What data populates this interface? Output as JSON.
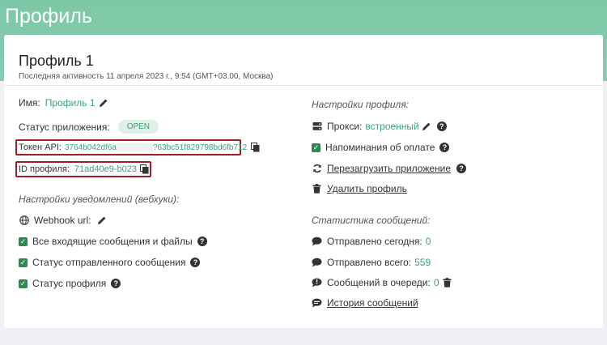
{
  "app": {
    "title": "Профиль"
  },
  "profile": {
    "title": "Профиль 1",
    "last_activity": "Последняя активность 11 апреля 2023 г., 9:54 (GMT+03.00, Москва)",
    "name_label": "Имя:",
    "name_value": "Профиль 1",
    "status_label": "Статус приложения:",
    "status_value": "OPEN",
    "token_label": "Токен API:",
    "token_value_start": "3764b042df6a",
    "token_value_end": "?63bc51f829798bd6fb712",
    "id_label": "ID профиля:",
    "id_value": "71ad40e9-b023"
  },
  "notifications": {
    "title": "Настройки уведомлений (вебхуки):",
    "webhook_label": "Webhook url:",
    "items": [
      "Все входящие сообщения и файлы",
      "Статус отправленного сообщения",
      "Статус профиля"
    ]
  },
  "settings": {
    "title": "Настройки профиля:",
    "proxy_label": "Прокси:",
    "proxy_value": "встроенный",
    "payment_reminders": "Напоминания об оплате",
    "restart_app": "Перезагрузить приложение",
    "delete_profile": "Удалить профиль"
  },
  "stats": {
    "title": "Статистика сообщений:",
    "sent_today_label": "Отправлено сегодня:",
    "sent_today_value": "0",
    "sent_total_label": "Отправлено всего:",
    "sent_total_value": "559",
    "queue_label": "Сообщений в очереди:",
    "queue_value": "0",
    "history": "История сообщений"
  },
  "colors": {
    "accent": "#3aa37a",
    "header": "#82cbac",
    "highlight": "#a31d24"
  }
}
